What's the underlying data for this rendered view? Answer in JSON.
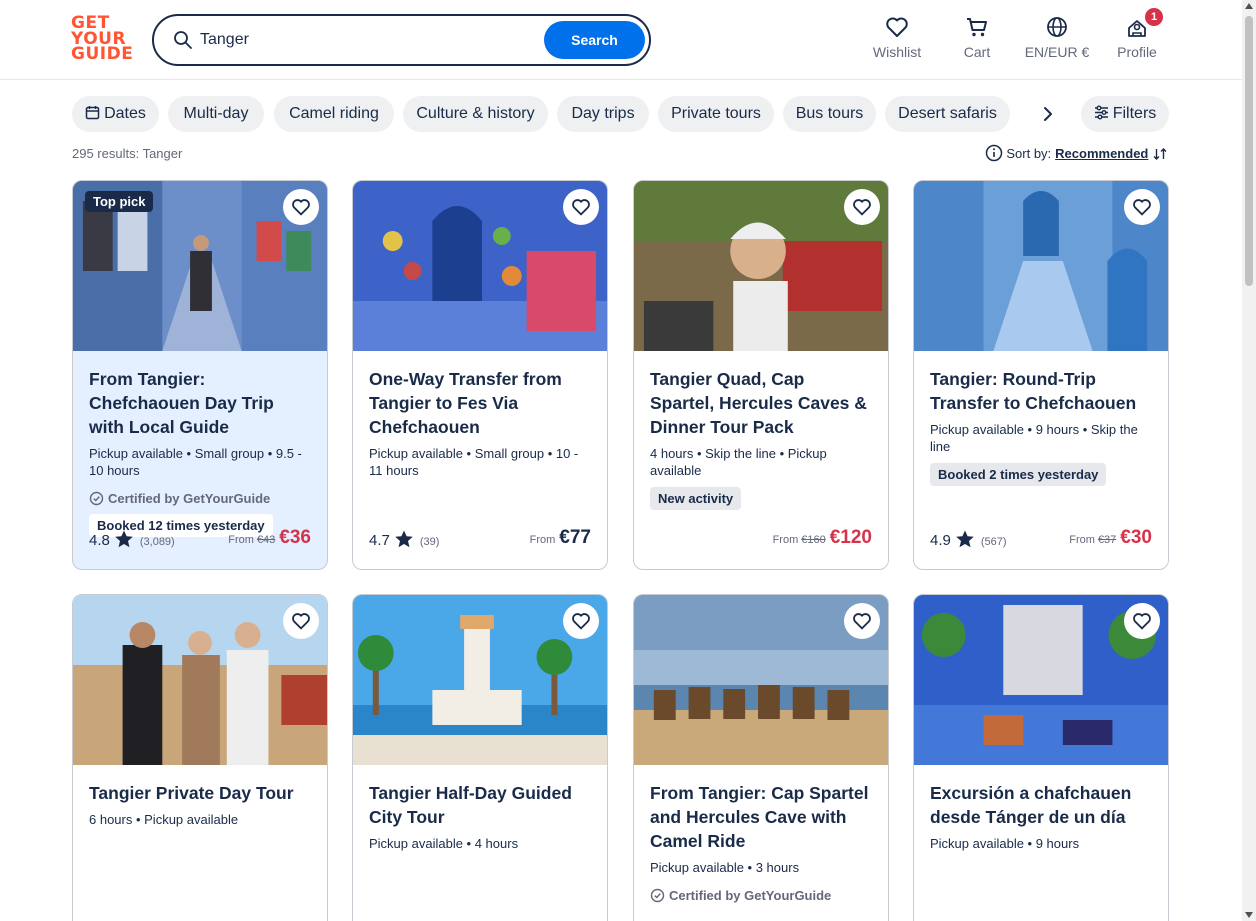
{
  "brand": {
    "logo_lines": [
      "GET",
      "YOUR",
      "GUIDE"
    ],
    "color": "#ff5533"
  },
  "search": {
    "value": "Tanger",
    "placeholder": "Search",
    "button_label": "Search",
    "button_color": "#0071eb"
  },
  "nav": {
    "wishlist": "Wishlist",
    "cart": "Cart",
    "language": "EN/EUR €",
    "profile": "Profile",
    "profile_badge": "1"
  },
  "filters": {
    "chips": [
      "Dates",
      "Multi-day",
      "Camel riding",
      "Culture & history",
      "Day trips",
      "Private tours",
      "Bus tours",
      "Desert safaris"
    ],
    "filters_label": "Filters"
  },
  "results": {
    "summary": "295 results: Tanger",
    "sort_label": "Sort by:",
    "sort_value": "Recommended"
  },
  "cards": [
    {
      "title": "From Tangier: Chefchaouen Day Trip with Local Guide",
      "meta": "Pickup available • Small group • 9.5 - 10 hours",
      "top_pick": "Top pick",
      "certified": "Certified by GetYourGuide",
      "booked": "Booked 12 times yesterday",
      "rating": "4.8",
      "reviews": "(3,089)",
      "from": "From",
      "old_price": "€43",
      "price": "€36"
    },
    {
      "title": "One-Way Transfer from Tangier to Fes Via Chefchaouen",
      "meta": "Pickup available • Small group • 10 - 11 hours",
      "rating": "4.7",
      "reviews": "(39)",
      "from": "From",
      "price": "€77"
    },
    {
      "title": "Tangier Quad, Cap Spartel, Hercules Caves & Dinner Tour Pack",
      "meta": "4 hours • Skip the line • Pickup available",
      "new_activity": "New activity",
      "from": "From",
      "old_price": "€160",
      "price": "€120"
    },
    {
      "title": "Tangier: Round-Trip Transfer to Chefchaouen",
      "meta": "Pickup available • 9 hours • Skip the line",
      "booked": "Booked 2 times yesterday",
      "rating": "4.9",
      "reviews": "(567)",
      "from": "From",
      "old_price": "€37",
      "price": "€30"
    },
    {
      "title": "Tangier Private Day Tour",
      "meta": "6 hours • Pickup available"
    },
    {
      "title": "Tangier Half-Day Guided City Tour",
      "meta": "Pickup available • 4 hours"
    },
    {
      "title": "From Tangier: Cap Spartel and Hercules Cave with Camel Ride",
      "meta": "Pickup available • 3 hours",
      "certified": "Certified by GetYourGuide"
    },
    {
      "title": "Excursión a chafchauen desde Tánger de un día",
      "meta": "Pickup available • 9 hours"
    }
  ],
  "colors": {
    "text": "#1a2b49",
    "sale": "#d6324a",
    "highlight_card": "#e4f0ff",
    "chip_bg": "#eef0f2"
  }
}
